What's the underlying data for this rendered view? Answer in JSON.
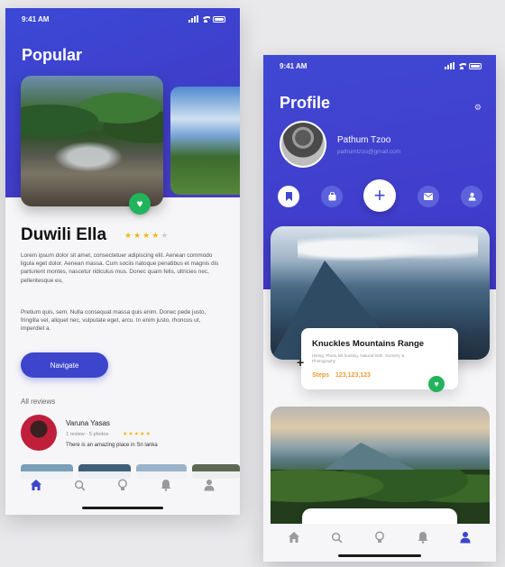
{
  "left_screen": {
    "status_time": "9:41 AM",
    "title": "Popular",
    "place_name": "Duwili Ella",
    "rating": 4,
    "rating_max": 5,
    "description_1": "Lorem ipsum dolor sit amet, consectetuer adipiscing elit. Aenean commodo ligula eget dolor. Aenean massa. Cum sociis natoque penatibus et magnis dis parturient montes, nascetur ridiculus mus. Donec quam felis, ultricies nec, pellentesque eu,",
    "description_2": "Pretium quis, sem. Nulla consequat massa quis enim. Donec pede justo, fringilla vel, aliquet nec, vulputate eget, arcu. In enim justo, rhoncus ut, imperdiet a.",
    "navigate_label": "Navigate",
    "reviews_label": "All reviews",
    "review": {
      "name": "Varuna Yasas",
      "meta": "1 review · 5 photos",
      "stars": "★★★★★",
      "text": "There is an amazing place in Sri lanka"
    },
    "tabs": [
      {
        "icon": "home-icon",
        "active": true
      },
      {
        "icon": "search-icon",
        "active": false
      },
      {
        "icon": "bulb-icon",
        "active": false
      },
      {
        "icon": "bell-icon",
        "active": false
      },
      {
        "icon": "user-icon",
        "active": false
      }
    ]
  },
  "right_screen": {
    "status_time": "9:41 AM",
    "title": "Profile",
    "user_name": "Pathum Tzoo",
    "user_email": "pathumtzoo@gmail.com",
    "card_title": "Knuckles Mountains Range",
    "card_tags": "Hiking, Photo fall hunting, Natural bath, Scenery & Photography",
    "steps_label": "Steps",
    "steps_value": "123,123,123",
    "tabs": [
      {
        "icon": "home-icon",
        "active": false
      },
      {
        "icon": "search-icon",
        "active": false
      },
      {
        "icon": "bulb-icon",
        "active": false
      },
      {
        "icon": "bell-icon",
        "active": false
      },
      {
        "icon": "user-icon",
        "active": true
      }
    ]
  },
  "colors": {
    "primary": "#3d45cc",
    "accent_green": "#22b45c",
    "star": "#f3b51b",
    "steps_orange": "#f09a36"
  }
}
